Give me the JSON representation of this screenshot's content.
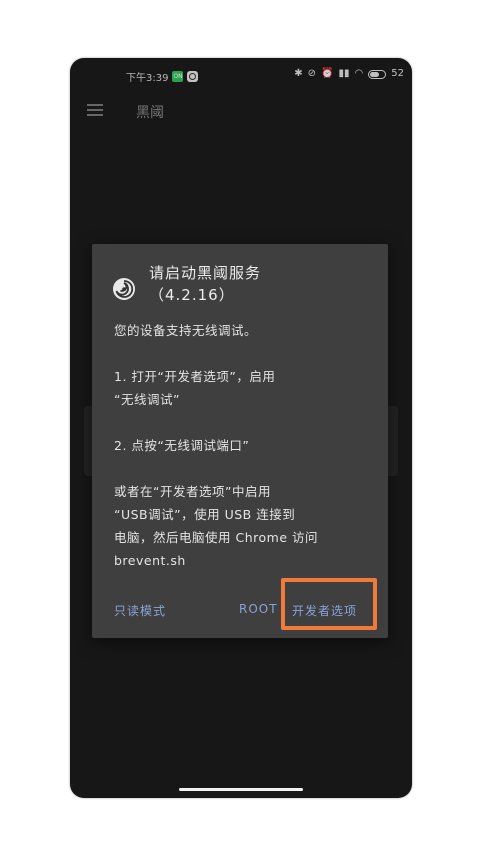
{
  "status_bar": {
    "time": "下午3:39",
    "badge_green": "ON",
    "battery_percent": "52"
  },
  "app_bar": {
    "title": "黑阈"
  },
  "dialog": {
    "title": "请启动黑阈服务",
    "version": "（4.2.16）",
    "body": [
      "您的设备支持无线调试。",
      "",
      "1. 打开“开发者选项”，启用",
      "“无线调试”",
      "",
      "2. 点按“无线调试端口”",
      "",
      "或者在“开发者选项”中启用",
      "“USB调试”，使用 USB 连接到",
      "电脑，然后电脑使用 Chrome 访问",
      "brevent.sh"
    ],
    "actions": {
      "readonly": "只读模式",
      "root": "ROOT",
      "developer_options": "开发者选项"
    }
  },
  "colors": {
    "dialog_bg": "#3f3f3f",
    "action_text": "#8aa3d8",
    "highlight_border": "#f07a3a",
    "screen_bg": "#1c1c1c"
  }
}
